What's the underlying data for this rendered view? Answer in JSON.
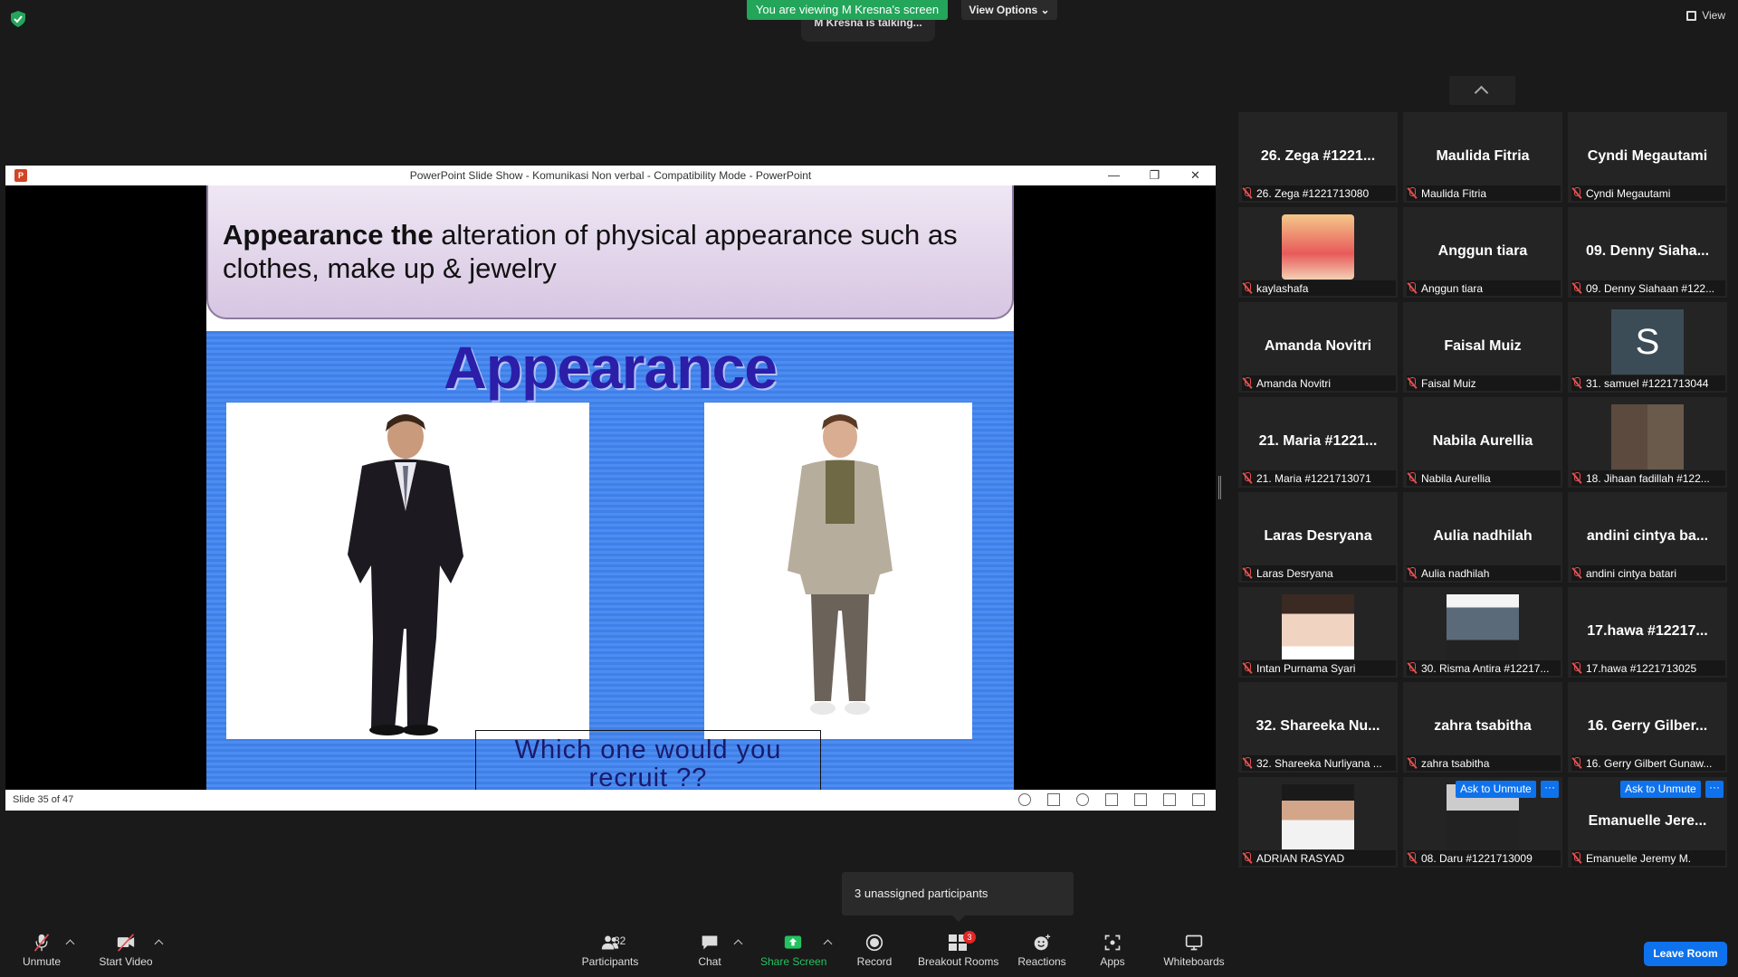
{
  "top": {
    "viewing_banner": "You are viewing M Kresna's screen",
    "talking": "M Kresna is talking...",
    "view_options": "View Options ⌄",
    "view_label": "View"
  },
  "ppt": {
    "title": "PowerPoint Slide Show  -  Komunikasi Non verbal  -  Compatibility Mode - PowerPoint",
    "logo": "P",
    "minimize": "—",
    "restore": "❐",
    "close": "✕",
    "slide_counter": "Slide 35 of 47",
    "slide": {
      "heading_bold": "Appearance the",
      "heading_rest": " alteration of physical appearance such as clothes, make up & jewelry",
      "big_title": "Appearance",
      "question": "Which one would you recruit ??"
    }
  },
  "gallery": {
    "tiles": [
      {
        "big": "26. Zega #1221...",
        "small": "26. Zega #1221713080"
      },
      {
        "big": "Maulida Fitria",
        "small": "Maulida Fitria"
      },
      {
        "big": "Cyndi Megautami",
        "small": "Cyndi Megautami"
      },
      {
        "big": "",
        "small": "kaylashafa"
      },
      {
        "big": "Anggun tiara",
        "small": "Anggun tiara"
      },
      {
        "big": "09. Denny Siaha...",
        "small": "09. Denny Siahaan #122..."
      },
      {
        "big": "Amanda Novitri",
        "small": "Amanda Novitri"
      },
      {
        "big": "Faisal Muiz",
        "small": "Faisal Muiz"
      },
      {
        "big": "",
        "small": "31. samuel #1221713044",
        "avatar": "S"
      },
      {
        "big": "21. Maria #1221...",
        "small": "21. Maria #1221713071"
      },
      {
        "big": "Nabila Aurellia",
        "small": "Nabila Aurellia"
      },
      {
        "big": "",
        "small": "18. Jihaan fadillah #122..."
      },
      {
        "big": "Laras Desryana",
        "small": "Laras Desryana"
      },
      {
        "big": "Aulia nadhilah",
        "small": "Aulia nadhilah"
      },
      {
        "big": "andini cintya ba...",
        "small": "andini cintya batari"
      },
      {
        "big": "",
        "small": "Intan Purnama Syari"
      },
      {
        "big": "",
        "small": "30. Risma Antira #12217..."
      },
      {
        "big": "17.hawa #12217...",
        "small": "17.hawa #1221713025"
      },
      {
        "big": "32. Shareeka Nu...",
        "small": "32. Shareeka Nurliyana ..."
      },
      {
        "big": "zahra tsabitha",
        "small": "zahra tsabitha"
      },
      {
        "big": "16. Gerry Gilber...",
        "small": "16. Gerry Gilbert Gunaw..."
      },
      {
        "big": "",
        "small": "ADRIAN RASYAD"
      },
      {
        "big": "",
        "small": "08. Daru #1221713009"
      },
      {
        "big": "Emanuelle Jere...",
        "small": "Emanuelle Jeremy M."
      }
    ],
    "ask_to_unmute": "Ask to Unmute",
    "more": "···"
  },
  "tooltip": "3 unassigned participants",
  "toolbar": {
    "unmute": "Unmute",
    "start_video": "Start Video",
    "participants": "Participants",
    "participants_count": "32",
    "chat": "Chat",
    "share_screen": "Share Screen",
    "record": "Record",
    "breakout_rooms": "Breakout Rooms",
    "breakout_badge": "3",
    "reactions": "Reactions",
    "apps": "Apps",
    "whiteboards": "Whiteboards",
    "leave": "Leave Room"
  },
  "colors": {
    "accent_green": "#23a55a",
    "accent_blue": "#0e72ed",
    "muted_red": "#e25050"
  }
}
